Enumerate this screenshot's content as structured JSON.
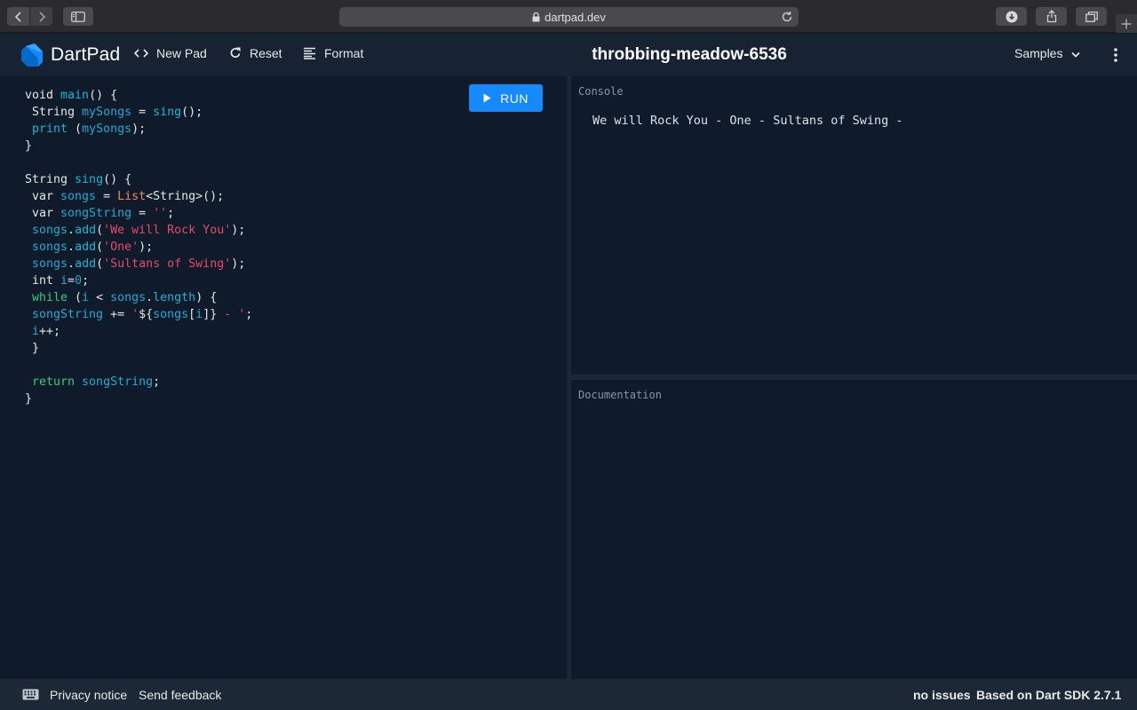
{
  "browser": {
    "url": "dartpad.dev"
  },
  "header": {
    "app_name": "DartPad",
    "new_pad_label": "New Pad",
    "reset_label": "Reset",
    "format_label": "Format",
    "pad_title": "throbbing-meadow-6536",
    "samples_label": "Samples"
  },
  "editor": {
    "run_label": "RUN",
    "lines": [
      [
        [
          "kw",
          "void "
        ],
        [
          "fn",
          "main"
        ],
        [
          "kw",
          "() {"
        ]
      ],
      [
        [
          "kw",
          " String "
        ],
        [
          "id",
          "mySongs"
        ],
        [
          "kw",
          " = "
        ],
        [
          "fn",
          "sing"
        ],
        [
          "kw",
          "();"
        ]
      ],
      [
        [
          "fn",
          " print"
        ],
        [
          "kw",
          " ("
        ],
        [
          "id",
          "mySongs"
        ],
        [
          "kw",
          ");"
        ]
      ],
      [
        [
          "kw",
          "}"
        ]
      ],
      [
        [
          "kw",
          ""
        ]
      ],
      [
        [
          "kw",
          "String "
        ],
        [
          "fn",
          "sing"
        ],
        [
          "kw",
          "() {"
        ]
      ],
      [
        [
          "kw",
          " var "
        ],
        [
          "id",
          "songs"
        ],
        [
          "kw",
          " = "
        ],
        [
          "cls",
          "List"
        ],
        [
          "kw",
          "<String>();"
        ]
      ],
      [
        [
          "kw",
          " var "
        ],
        [
          "id",
          "songString"
        ],
        [
          "kw",
          " = "
        ],
        [
          "str",
          "''"
        ],
        [
          "kw",
          ";"
        ]
      ],
      [
        [
          "id",
          " songs"
        ],
        [
          "kw",
          "."
        ],
        [
          "fn",
          "add"
        ],
        [
          "kw",
          "("
        ],
        [
          "str",
          "'We will Rock You'"
        ],
        [
          "kw",
          ");"
        ]
      ],
      [
        [
          "id",
          " songs"
        ],
        [
          "kw",
          "."
        ],
        [
          "fn",
          "add"
        ],
        [
          "kw",
          "("
        ],
        [
          "str",
          "'One'"
        ],
        [
          "kw",
          ");"
        ]
      ],
      [
        [
          "id",
          " songs"
        ],
        [
          "kw",
          "."
        ],
        [
          "fn",
          "add"
        ],
        [
          "kw",
          "("
        ],
        [
          "str",
          "'Sultans of Swing'"
        ],
        [
          "kw",
          ");"
        ]
      ],
      [
        [
          "kw",
          " int "
        ],
        [
          "id",
          "i"
        ],
        [
          "kw",
          "="
        ],
        [
          "num",
          "0"
        ],
        [
          "kw",
          ";"
        ]
      ],
      [
        [
          "ctl",
          " while"
        ],
        [
          "kw",
          " ("
        ],
        [
          "id",
          "i"
        ],
        [
          "kw",
          " < "
        ],
        [
          "id",
          "songs"
        ],
        [
          "kw",
          "."
        ],
        [
          "fn",
          "length"
        ],
        [
          "kw",
          ") {"
        ]
      ],
      [
        [
          "id",
          " songString"
        ],
        [
          "kw",
          " += "
        ],
        [
          "str",
          "'"
        ],
        [
          "kw",
          "${"
        ],
        [
          "id",
          "songs"
        ],
        [
          "kw",
          "["
        ],
        [
          "id",
          "i"
        ],
        [
          "kw",
          "]}"
        ],
        [
          "str",
          " - '"
        ],
        [
          "kw",
          ";"
        ]
      ],
      [
        [
          "id",
          " i"
        ],
        [
          "kw",
          "++;"
        ]
      ],
      [
        [
          "kw",
          " }"
        ]
      ],
      [
        [
          "kw",
          ""
        ]
      ],
      [
        [
          "ctl",
          " return "
        ],
        [
          "id",
          "songString"
        ],
        [
          "kw",
          ";"
        ]
      ],
      [
        [
          "kw",
          "}"
        ]
      ]
    ]
  },
  "console": {
    "label": "Console",
    "output": "We will Rock You - One - Sultans of Swing - "
  },
  "documentation": {
    "label": "Documentation"
  },
  "footer": {
    "privacy_label": "Privacy notice",
    "feedback_label": "Send feedback",
    "issues_label": "no issues",
    "sdk_label": "Based on Dart SDK 2.7.1"
  },
  "colors": {
    "run_button": "#168afd",
    "background": "#0f1b2a",
    "header": "#172332",
    "string": "#e9486a",
    "function": "#22b4d4",
    "control": "#3ec97c"
  }
}
